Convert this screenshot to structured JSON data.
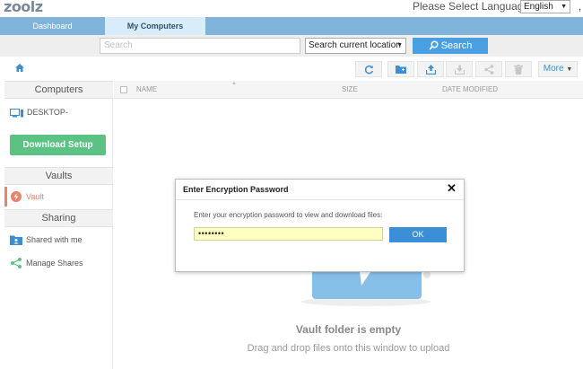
{
  "app": {
    "logo": "zoolz"
  },
  "language": {
    "label": "Please Select Language :",
    "selected": "English"
  },
  "nav": {
    "tabs": [
      {
        "label": "Dashboard"
      },
      {
        "label": "My Computers"
      }
    ]
  },
  "search": {
    "placeholder": "Search",
    "location_selected": "Search current location",
    "button_label": "Search"
  },
  "toolbar": {
    "more_label": "More"
  },
  "sidebar": {
    "computers_heading": "Computers",
    "computer_name": "DESKTOP-",
    "download_label": "Download Setup",
    "vaults_heading": "Vaults",
    "vault_label": "Vault",
    "sharing_heading": "Sharing",
    "shared_with_me": "Shared with me",
    "manage_shares": "Manage Shares"
  },
  "list": {
    "columns": [
      "NAME",
      "SIZE",
      "DATE MODIFIED"
    ]
  },
  "empty": {
    "title": "Vault folder is empty",
    "subtitle": "Drag and drop files onto this window to upload"
  },
  "modal": {
    "title": "Enter Encryption Password",
    "message": "Enter your encryption password to view and download files:",
    "password_value": "••••••••",
    "ok_label": "OK"
  },
  "colors": {
    "accent": "#4a9fe0",
    "nav": "#7fb3d9",
    "download": "#5cc283",
    "vault": "#e8836b"
  }
}
